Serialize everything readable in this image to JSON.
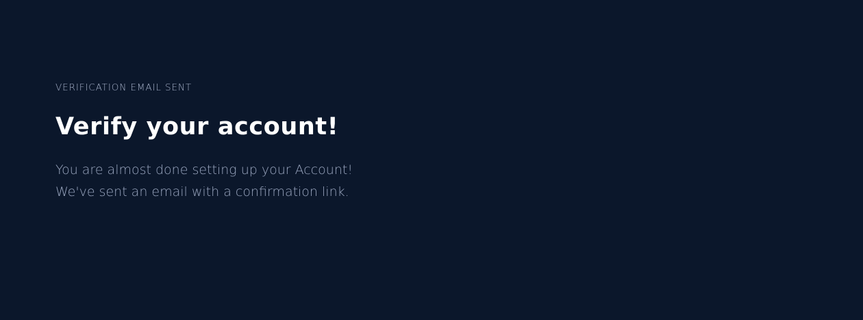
{
  "verification": {
    "eyebrow": "VERIFICATION EMAIL SENT",
    "title": "Verify your account!",
    "message": "You are almost done setting up your Account! We've sent an email with a confirmation link."
  },
  "colors": {
    "background": "#0b172b",
    "title": "#ffffff",
    "eyebrow": "#a5b0c8",
    "body": "#9aa6bf"
  }
}
